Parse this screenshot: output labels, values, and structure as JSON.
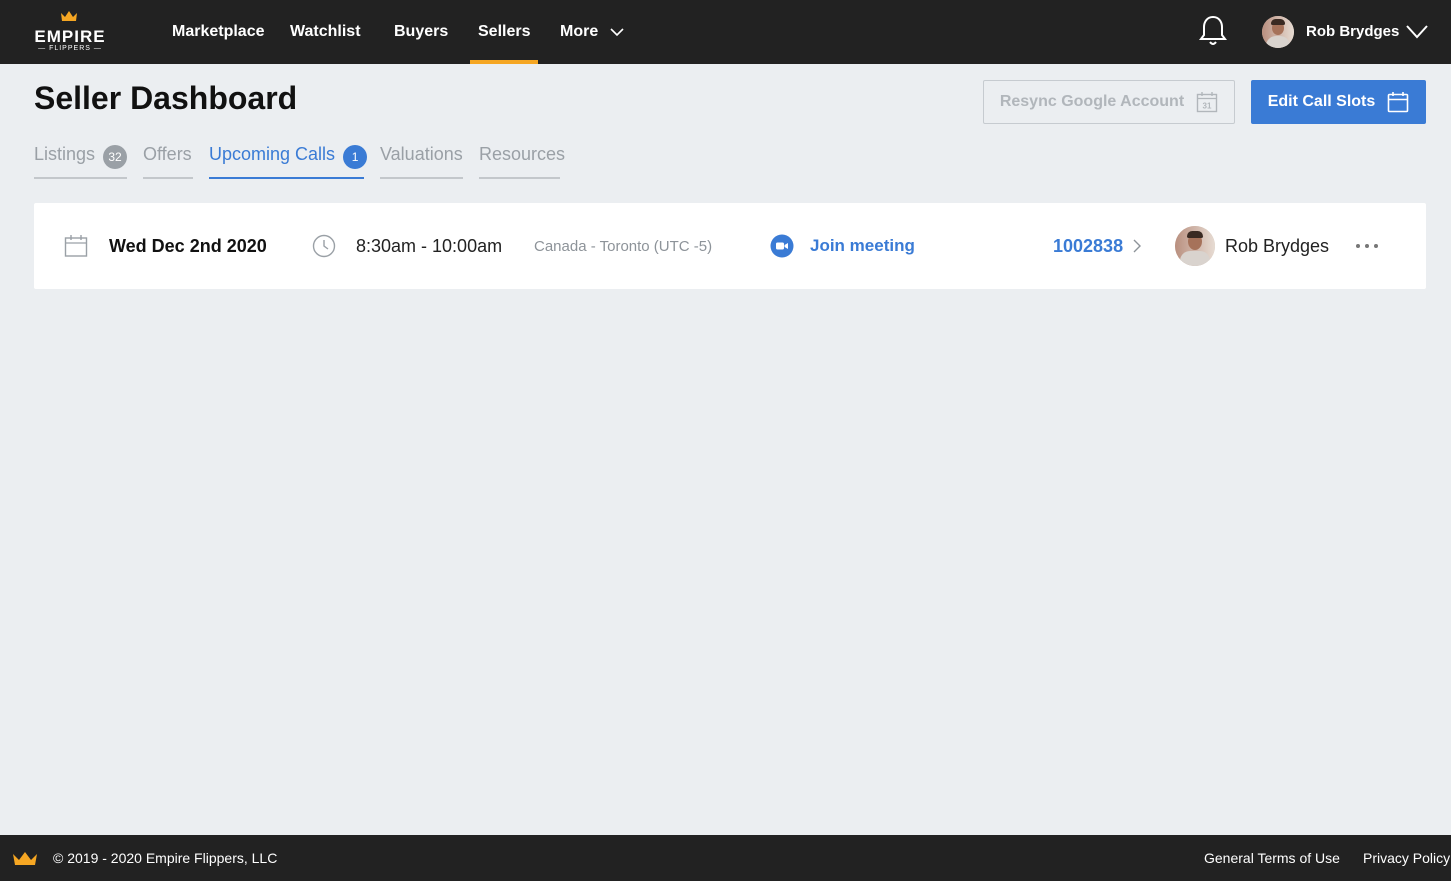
{
  "brand": {
    "logo_word": "EMPIRE",
    "logo_sub": "— FLIPPERS —",
    "accent": "#f5a623",
    "primary": "#3a7bd5"
  },
  "nav": {
    "items": [
      {
        "label": "Marketplace"
      },
      {
        "label": "Watchlist"
      },
      {
        "label": "Buyers"
      },
      {
        "label": "Sellers",
        "active": true
      },
      {
        "label": "More"
      }
    ],
    "user_name": "Rob Brydges"
  },
  "header": {
    "title": "Seller Dashboard",
    "resync_label": "Resync Google Account",
    "edit_label": "Edit Call Slots",
    "calendar_day": "31"
  },
  "tabs": [
    {
      "label": "Listings",
      "badge": "32"
    },
    {
      "label": "Offers"
    },
    {
      "label": "Upcoming Calls",
      "badge": "1",
      "active": true
    },
    {
      "label": "Valuations"
    },
    {
      "label": "Resources"
    }
  ],
  "calls": [
    {
      "date": "Wed Dec 2nd 2020",
      "time": "8:30am - 10:00am",
      "timezone": "Canada - Toronto (UTC -5)",
      "join_label": "Join meeting",
      "listing_id": "1002838",
      "host": "Rob Brydges"
    }
  ],
  "footer": {
    "copyright": "© 2019 - 2020 Empire Flippers, LLC",
    "terms": "General Terms of Use",
    "privacy": "Privacy Policy"
  }
}
